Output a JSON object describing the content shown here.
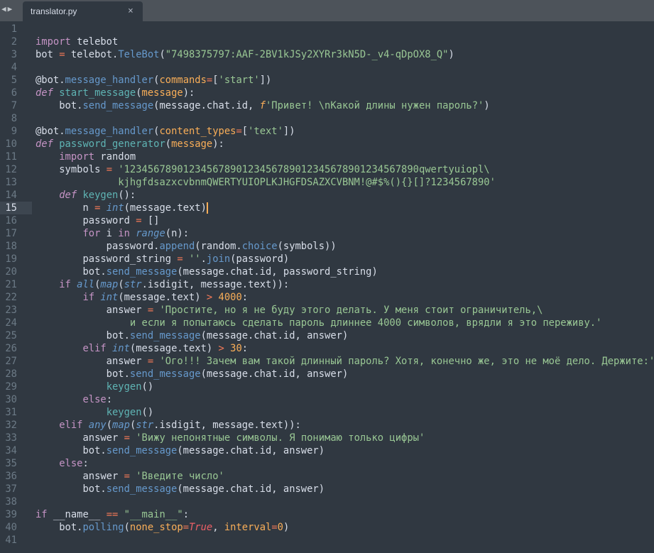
{
  "tab": {
    "title": "translator.py",
    "close": "×",
    "nav": "◀▶"
  },
  "current_line": 15,
  "lines": [
    [],
    [
      [
        "k",
        "import"
      ],
      [
        "t",
        " telebot"
      ]
    ],
    [
      [
        "t",
        "bot "
      ],
      [
        "o",
        "="
      ],
      [
        "t",
        " telebot."
      ],
      [
        "f",
        "TeleBot"
      ],
      [
        "t",
        "("
      ],
      [
        "s",
        "\"7498375797:AAF-2BV1kJSy2XYRr3kN5D-_v4-qDpOX8_Q\""
      ],
      [
        "t",
        ")"
      ]
    ],
    [],
    [
      [
        "t",
        "@bot."
      ],
      [
        "f",
        "message_handler"
      ],
      [
        "t",
        "("
      ],
      [
        "p",
        "commands"
      ],
      [
        "o",
        "="
      ],
      [
        "t",
        "["
      ],
      [
        "s",
        "'start'"
      ],
      [
        "t",
        "])"
      ]
    ],
    [
      [
        "i",
        "def"
      ],
      [
        "t",
        " "
      ],
      [
        "fd",
        "start_message"
      ],
      [
        "t",
        "("
      ],
      [
        "p",
        "message"
      ],
      [
        "t",
        "):"
      ]
    ],
    [
      [
        "t",
        "    bot."
      ],
      [
        "f",
        "send_message"
      ],
      [
        "t",
        "(message.chat.id, "
      ],
      [
        "sp",
        "f"
      ],
      [
        "s",
        "'Привет! \\nКакой длины нужен пароль?'"
      ],
      [
        "t",
        ")"
      ]
    ],
    [],
    [
      [
        "t",
        "@bot."
      ],
      [
        "f",
        "message_handler"
      ],
      [
        "t",
        "("
      ],
      [
        "p",
        "content_types"
      ],
      [
        "o",
        "="
      ],
      [
        "t",
        "["
      ],
      [
        "s",
        "'text'"
      ],
      [
        "t",
        "])"
      ]
    ],
    [
      [
        "i",
        "def"
      ],
      [
        "t",
        " "
      ],
      [
        "fd",
        "password_generator"
      ],
      [
        "t",
        "("
      ],
      [
        "p",
        "message"
      ],
      [
        "t",
        "):"
      ]
    ],
    [
      [
        "t",
        "    "
      ],
      [
        "k",
        "import"
      ],
      [
        "t",
        " random"
      ]
    ],
    [
      [
        "t",
        "    symbols "
      ],
      [
        "o",
        "="
      ],
      [
        "t",
        " "
      ],
      [
        "s",
        "'12345678901234567890123456789012345678901234567890qwertyuiopl\\"
      ]
    ],
    [
      [
        "t",
        "              "
      ],
      [
        "s",
        "kjhgfdsazxcvbnmQWERTYUIOPLKJHGFDSAZXCVBNM!@#$%(){}[]?1234567890'"
      ]
    ],
    [
      [
        "t",
        "    "
      ],
      [
        "i",
        "def"
      ],
      [
        "t",
        " "
      ],
      [
        "fd",
        "keygen"
      ],
      [
        "t",
        "():"
      ]
    ],
    [
      [
        "t",
        "        n "
      ],
      [
        "o",
        "="
      ],
      [
        "t",
        " "
      ],
      [
        "b",
        "int"
      ],
      [
        "t",
        "(message.text)"
      ]
    ],
    [
      [
        "t",
        "        password "
      ],
      [
        "o",
        "="
      ],
      [
        "t",
        " []"
      ]
    ],
    [
      [
        "t",
        "        "
      ],
      [
        "k",
        "for"
      ],
      [
        "t",
        " i "
      ],
      [
        "k",
        "in"
      ],
      [
        "t",
        " "
      ],
      [
        "b",
        "range"
      ],
      [
        "t",
        "(n):"
      ]
    ],
    [
      [
        "t",
        "            password."
      ],
      [
        "f",
        "append"
      ],
      [
        "t",
        "(random."
      ],
      [
        "f",
        "choice"
      ],
      [
        "t",
        "(symbols))"
      ]
    ],
    [
      [
        "t",
        "        password_string "
      ],
      [
        "o",
        "="
      ],
      [
        "t",
        " "
      ],
      [
        "s",
        "''"
      ],
      [
        "t",
        "."
      ],
      [
        "f",
        "join"
      ],
      [
        "t",
        "(password)"
      ]
    ],
    [
      [
        "t",
        "        bot."
      ],
      [
        "f",
        "send_message"
      ],
      [
        "t",
        "(message.chat.id, password_string)"
      ]
    ],
    [
      [
        "t",
        "    "
      ],
      [
        "k",
        "if"
      ],
      [
        "t",
        " "
      ],
      [
        "b",
        "all"
      ],
      [
        "t",
        "("
      ],
      [
        "b",
        "map"
      ],
      [
        "t",
        "("
      ],
      [
        "b",
        "str"
      ],
      [
        "t",
        ".isdigit, message.text)):"
      ]
    ],
    [
      [
        "t",
        "        "
      ],
      [
        "k",
        "if"
      ],
      [
        "t",
        " "
      ],
      [
        "b",
        "int"
      ],
      [
        "t",
        "(message.text) "
      ],
      [
        "o",
        ">"
      ],
      [
        "t",
        " "
      ],
      [
        "n",
        "4000"
      ],
      [
        "t",
        ":"
      ]
    ],
    [
      [
        "t",
        "            answer "
      ],
      [
        "o",
        "="
      ],
      [
        "t",
        " "
      ],
      [
        "s",
        "'Простите, но я не буду этого делать. У меня стоит ограничитель,\\"
      ]
    ],
    [
      [
        "t",
        "                "
      ],
      [
        "s",
        "и если я попытаюсь сделать пароль длиннее 4000 символов, врядли я это переживу.'"
      ]
    ],
    [
      [
        "t",
        "            bot."
      ],
      [
        "f",
        "send_message"
      ],
      [
        "t",
        "(message.chat.id, answer)"
      ]
    ],
    [
      [
        "t",
        "        "
      ],
      [
        "k",
        "elif"
      ],
      [
        "t",
        " "
      ],
      [
        "b",
        "int"
      ],
      [
        "t",
        "(message.text) "
      ],
      [
        "o",
        ">"
      ],
      [
        "t",
        " "
      ],
      [
        "n",
        "30"
      ],
      [
        "t",
        ":"
      ]
    ],
    [
      [
        "t",
        "            answer "
      ],
      [
        "o",
        "="
      ],
      [
        "t",
        " "
      ],
      [
        "s",
        "'Ого!!! Зачем вам такой длинный пароль? Хотя, конечно же, это не моё дело. Держите:'"
      ]
    ],
    [
      [
        "t",
        "            bot."
      ],
      [
        "f",
        "send_message"
      ],
      [
        "t",
        "(message.chat.id, answer)"
      ]
    ],
    [
      [
        "t",
        "            "
      ],
      [
        "fd",
        "keygen"
      ],
      [
        "t",
        "()"
      ]
    ],
    [
      [
        "t",
        "        "
      ],
      [
        "k",
        "else"
      ],
      [
        "t",
        ":"
      ]
    ],
    [
      [
        "t",
        "            "
      ],
      [
        "fd",
        "keygen"
      ],
      [
        "t",
        "()"
      ]
    ],
    [
      [
        "t",
        "    "
      ],
      [
        "k",
        "elif"
      ],
      [
        "t",
        " "
      ],
      [
        "b",
        "any"
      ],
      [
        "t",
        "("
      ],
      [
        "b",
        "map"
      ],
      [
        "t",
        "("
      ],
      [
        "b",
        "str"
      ],
      [
        "t",
        ".isdigit, message.text)):"
      ]
    ],
    [
      [
        "t",
        "        answer "
      ],
      [
        "o",
        "="
      ],
      [
        "t",
        " "
      ],
      [
        "s",
        "'Вижу непонятные символы. Я понимаю только цифры'"
      ]
    ],
    [
      [
        "t",
        "        bot."
      ],
      [
        "f",
        "send_message"
      ],
      [
        "t",
        "(message.chat.id, answer)"
      ]
    ],
    [
      [
        "t",
        "    "
      ],
      [
        "k",
        "else"
      ],
      [
        "t",
        ":"
      ]
    ],
    [
      [
        "t",
        "        answer "
      ],
      [
        "o",
        "="
      ],
      [
        "t",
        " "
      ],
      [
        "s",
        "'Введите число'"
      ]
    ],
    [
      [
        "t",
        "        bot."
      ],
      [
        "f",
        "send_message"
      ],
      [
        "t",
        "(message.chat.id, answer)"
      ]
    ],
    [],
    [
      [
        "k",
        "if"
      ],
      [
        "t",
        " __name__ "
      ],
      [
        "o",
        "=="
      ],
      [
        "t",
        " "
      ],
      [
        "s",
        "\"__main__\""
      ],
      [
        "t",
        ":"
      ]
    ],
    [
      [
        "t",
        "    bot."
      ],
      [
        "f",
        "polling"
      ],
      [
        "t",
        "("
      ],
      [
        "p",
        "none_stop"
      ],
      [
        "o",
        "="
      ],
      [
        "c",
        "True"
      ],
      [
        "t",
        ", "
      ],
      [
        "p",
        "interval"
      ],
      [
        "o",
        "="
      ],
      [
        "n",
        "0"
      ],
      [
        "t",
        ")"
      ]
    ],
    []
  ]
}
